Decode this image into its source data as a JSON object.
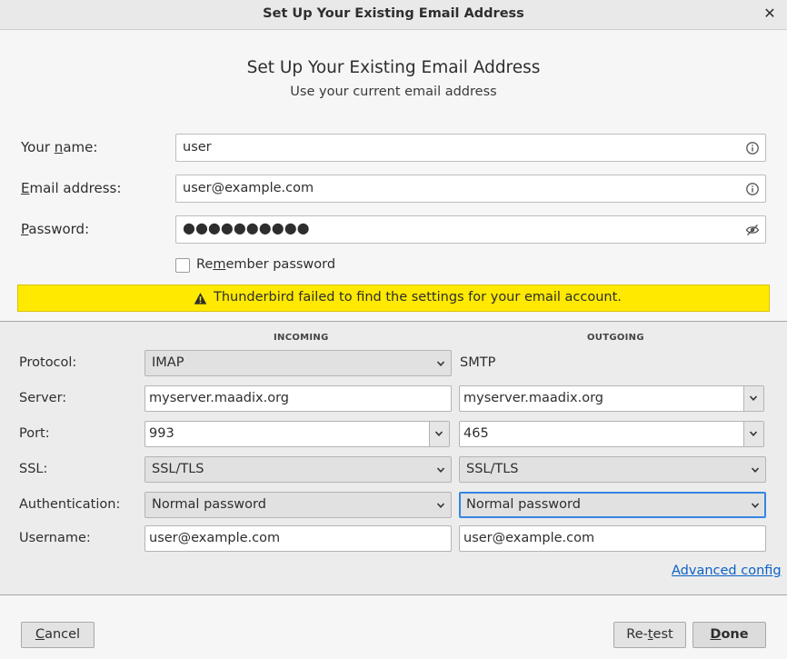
{
  "window": {
    "title": "Set Up Your Existing Email Address",
    "close_icon": "close-icon"
  },
  "header": {
    "title": "Set Up Your Existing Email Address",
    "subtitle": "Use your current email address"
  },
  "form": {
    "name": {
      "label_pre": "Your ",
      "label_key": "n",
      "label_post": "ame:",
      "value": "user",
      "icon": "info-icon"
    },
    "email": {
      "label_pre": "",
      "label_key": "E",
      "label_post": "mail address:",
      "value": "user@example.com",
      "icon": "info-icon"
    },
    "password": {
      "label_pre": "",
      "label_key": "P",
      "label_post": "assword:",
      "value": "●●●●●●●●●●",
      "icon": "eye-hidden-icon"
    },
    "remember": {
      "label_pre": "Re",
      "label_key": "m",
      "label_post": "ember password",
      "checked": false
    }
  },
  "warning": {
    "icon": "warning-icon",
    "text": "Thunderbird failed to find the settings for your email account."
  },
  "config": {
    "incoming_header": "INCOMING",
    "outgoing_header": "OUTGOING",
    "labels": {
      "protocol": "Protocol:",
      "server": "Server:",
      "port": "Port:",
      "ssl": "SSL:",
      "authentication": "Authentication:",
      "username": "Username:"
    },
    "incoming": {
      "protocol": "IMAP",
      "server": "myserver.maadix.org",
      "port": "993",
      "ssl": "SSL/TLS",
      "authentication": "Normal password",
      "username": "user@example.com"
    },
    "outgoing": {
      "protocol": "SMTP",
      "server": "myserver.maadix.org",
      "port": "465",
      "ssl": "SSL/TLS",
      "authentication": "Normal password",
      "username": "user@example.com"
    },
    "advanced": {
      "key": "A",
      "rest": "dvanced config"
    }
  },
  "buttons": {
    "cancel": {
      "key": "C",
      "rest": "ancel"
    },
    "retest": {
      "pre": "Re-",
      "key": "t",
      "rest": "est"
    },
    "done": {
      "key": "D",
      "rest": "one"
    }
  },
  "colors": {
    "warning_bg": "#ffe900",
    "link": "#0a61c6",
    "focus": "#3584e4"
  }
}
